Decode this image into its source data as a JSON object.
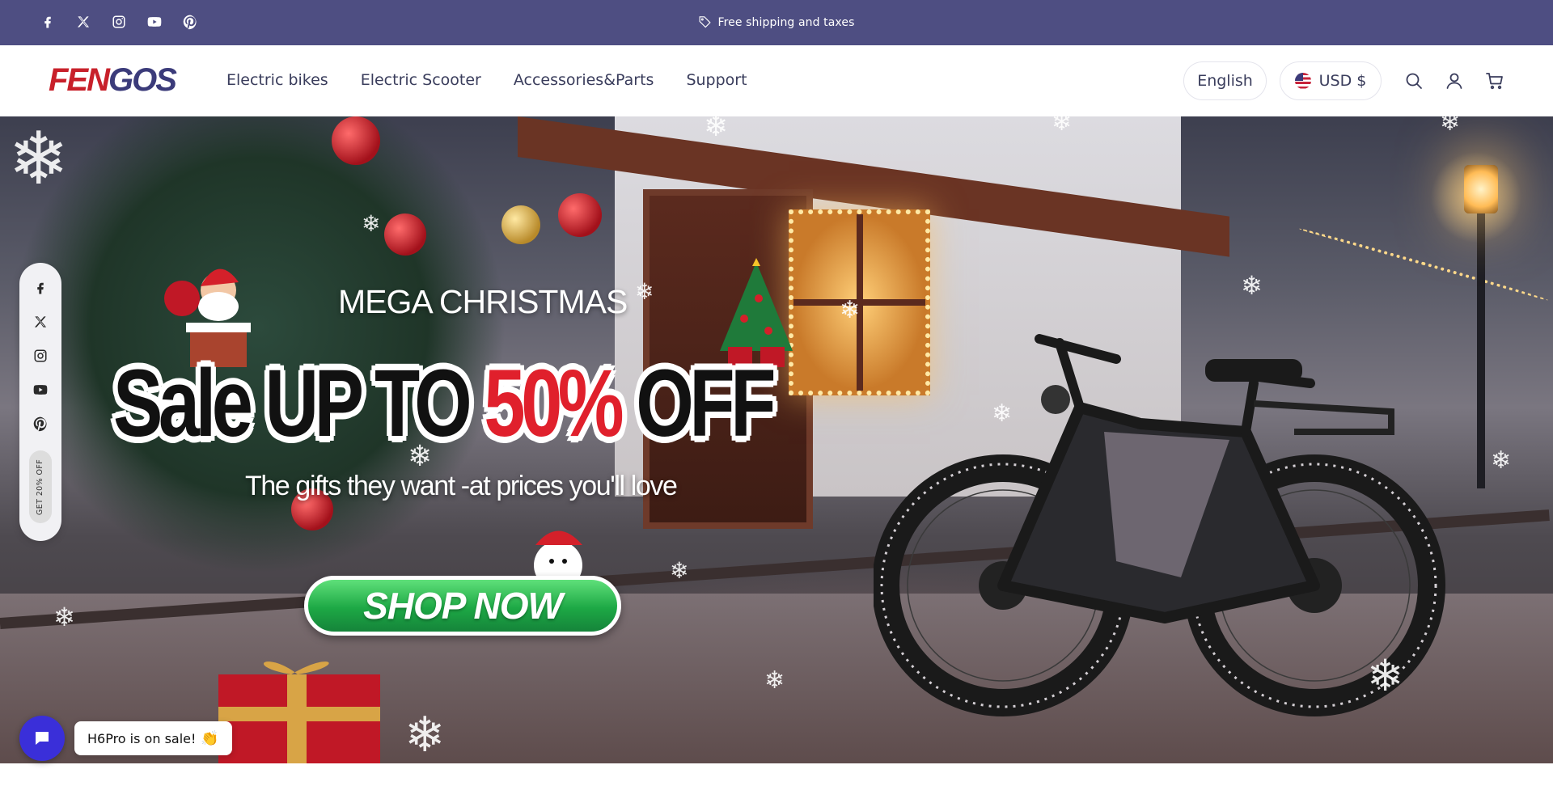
{
  "announcement": {
    "text": "Free shipping and taxes",
    "socials": [
      "facebook-icon",
      "x-icon",
      "instagram-icon",
      "youtube-icon",
      "pinterest-icon"
    ]
  },
  "header": {
    "logo_text": "FENGOS",
    "nav": [
      "Electric bikes",
      "Electric Scooter",
      "Accessories&Parts",
      "Support"
    ],
    "language": "English",
    "currency": "USD $",
    "icons": [
      "search-icon",
      "account-icon",
      "cart-icon"
    ]
  },
  "hero": {
    "eyebrow": "MEGA CHRISTMAS",
    "headline_start": "Sale UP TO ",
    "headline_accent": "50%",
    "headline_end": " OFF",
    "subtitle": "The gifts they want -at prices you'll love",
    "cta": "SHOP NOW"
  },
  "sidebar": {
    "icons": [
      "facebook-icon",
      "x-icon",
      "instagram-icon",
      "youtube-icon",
      "pinterest-icon"
    ],
    "offer": "GET 20% OFF"
  },
  "chat": {
    "message": "H6Pro is on sale!",
    "emoji": "👏"
  },
  "colors": {
    "announcement_bg": "#4e4e82",
    "brand_red": "#c8202a",
    "brand_navy": "#3b3b7a",
    "cta_green": "#1da845",
    "sale_red": "#e0202c",
    "chat_button": "#3a2fd9"
  }
}
